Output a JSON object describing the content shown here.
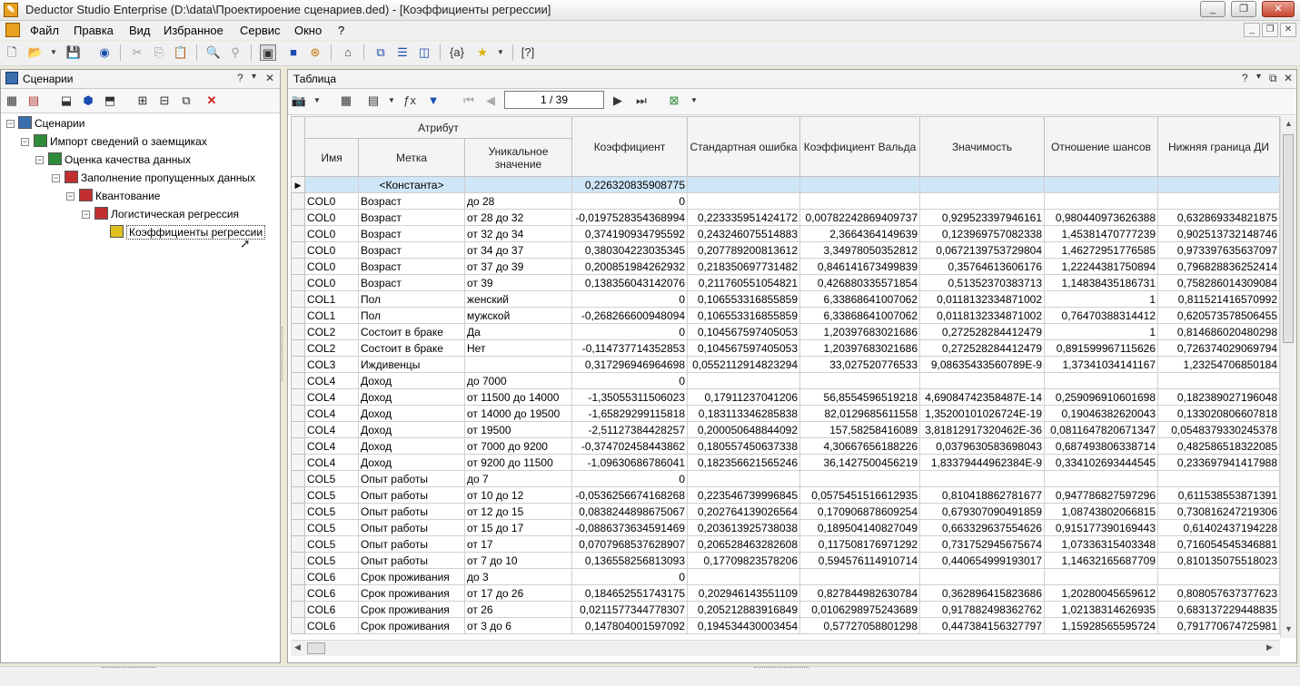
{
  "window": {
    "title": "Deductor Studio Enterprise (D:\\data\\Проектироение сценариев.ded) - [Коэффициенты регрессии]",
    "minimize": "_",
    "restore": "❐",
    "close": "✕"
  },
  "menu": [
    "Файл",
    "Правка",
    "Вид",
    "Избранное",
    "Сервис",
    "Окно",
    "?"
  ],
  "left_panel": {
    "title": "Сценарии",
    "help": "?",
    "pin": "▾",
    "close": "✕",
    "tree": [
      {
        "label": "Сценарии",
        "level": 0,
        "icon_color": "#3a6fb0"
      },
      {
        "label": "Импорт сведений о заемщиках",
        "level": 1,
        "icon_color": "#2e8b3a"
      },
      {
        "label": "Оценка качества данных",
        "level": 2,
        "icon_color": "#2e8b3a"
      },
      {
        "label": "Заполнение пропущенных данных",
        "level": 3,
        "icon_color": "#c03030"
      },
      {
        "label": "Квантование",
        "level": 4,
        "icon_color": "#c03030"
      },
      {
        "label": "Логистическая регрессия",
        "level": 5,
        "icon_color": "#c03030"
      },
      {
        "label": "Коэффициенты регрессии",
        "level": 6,
        "icon_color": "#e0c020"
      }
    ]
  },
  "right_panel": {
    "title": "Таблица",
    "help": "?",
    "pin": "▾",
    "float": "⧉",
    "close": "✕",
    "pager": "1 / 39"
  },
  "table": {
    "group_header": "Атрибут",
    "columns": [
      "Имя",
      "Метка",
      "Уникальное значение",
      "Коэффициент",
      "Стандартная ошибка",
      "Коэффициент Вальда",
      "Значимость",
      "Отношение шансов",
      "Нижняя граница ДИ"
    ],
    "rows": [
      [
        "",
        "<Константа>",
        "",
        "0,226320835908775",
        "",
        "",
        "",
        "",
        ""
      ],
      [
        "COL0",
        "Возраст",
        "до 28",
        "0",
        "",
        "",
        "",
        "",
        ""
      ],
      [
        "COL0",
        "Возраст",
        "от 28 до 32",
        "-0,0197528354368994",
        "0,223335951424172",
        "0,00782242869409737",
        "0,929523397946161",
        "0,980440973626388",
        "0,632869334821875"
      ],
      [
        "COL0",
        "Возраст",
        "от 32 до 34",
        "0,374190934795592",
        "0,243246075514883",
        "2,3664364149639",
        "0,123969757082338",
        "1,45381470777239",
        "0,902513732148746"
      ],
      [
        "COL0",
        "Возраст",
        "от 34 до 37",
        "0,380304223035345",
        "0,207789200813612",
        "3,34978050352812",
        "0,0672139753729804",
        "1,46272951776585",
        "0,973397635637097"
      ],
      [
        "COL0",
        "Возраст",
        "от 37 до 39",
        "0,200851984262932",
        "0,218350697731482",
        "0,846141673499839",
        "0,35764613606176",
        "1,22244381750894",
        "0,796828836252414"
      ],
      [
        "COL0",
        "Возраст",
        "от 39",
        "0,138356043142076",
        "0,211760551054821",
        "0,426880335571854",
        "0,51352370383713",
        "1,14838435186731",
        "0,758286014309084"
      ],
      [
        "COL1",
        "Пол",
        "женский",
        "0",
        "0,106553316855859",
        "6,33868641007062",
        "0,0118132334871002",
        "1",
        "0,811521416570992"
      ],
      [
        "COL1",
        "Пол",
        "мужской",
        "-0,268266600948094",
        "0,106553316855859",
        "6,33868641007062",
        "0,0118132334871002",
        "0,76470388314412",
        "0,620573578506455"
      ],
      [
        "COL2",
        "Состоит в браке",
        "Да",
        "0",
        "0,104567597405053",
        "1,20397683021686",
        "0,272528284412479",
        "1",
        "0,814686020480298"
      ],
      [
        "COL2",
        "Состоит в браке",
        "Нет",
        "-0,114737714352853",
        "0,104567597405053",
        "1,20397683021686",
        "0,272528284412479",
        "0,891599967115626",
        "0,726374029069794"
      ],
      [
        "COL3",
        "Иждивенцы",
        "",
        "0,317296946964698",
        "0,0552112914823294",
        "33,027520776533",
        "9,08635433560789E-9",
        "1,37341034141167",
        "1,23254706850184"
      ],
      [
        "COL4",
        "Доход",
        "до 7000",
        "0",
        "",
        "",
        "",
        "",
        ""
      ],
      [
        "COL4",
        "Доход",
        "от 11500 до 14000",
        "-1,35055311506023",
        "0,17911237041206",
        "56,8554596519218",
        "4,69084742358487E-14",
        "0,259096910601698",
        "0,182389027196048"
      ],
      [
        "COL4",
        "Доход",
        "от 14000 до 19500",
        "-1,65829299115818",
        "0,183113346285838",
        "82,0129685611558",
        "1,35200101026724E-19",
        "0,19046382620043",
        "0,133020806607818"
      ],
      [
        "COL4",
        "Доход",
        "от 19500",
        "-2,51127384428257",
        "0,200050648844092",
        "157,58258416089",
        "3,81812917320462E-36",
        "0,0811647820671347",
        "0,0548379330245378"
      ],
      [
        "COL4",
        "Доход",
        "от 7000 до 9200",
        "-0,374702458443862",
        "0,180557450637338",
        "4,30667656188226",
        "0,0379630583698043",
        "0,687493806338714",
        "0,482586518322085"
      ],
      [
        "COL4",
        "Доход",
        "от 9200 до 11500",
        "-1,09630686786041",
        "0,182356621565246",
        "36,1427500456219",
        "1,83379444962384E-9",
        "0,334102693444545",
        "0,233697941417988"
      ],
      [
        "COL5",
        "Опыт работы",
        "до 7",
        "0",
        "",
        "",
        "",
        "",
        ""
      ],
      [
        "COL5",
        "Опыт работы",
        "от 10 до 12",
        "-0,0536256674168268",
        "0,223546739996845",
        "0,0575451516612935",
        "0,810418862781677",
        "0,947786827597296",
        "0,611538553871391"
      ],
      [
        "COL5",
        "Опыт работы",
        "от 12 до 15",
        "0,0838244898675067",
        "0,202764139026564",
        "0,170906878609254",
        "0,679307090491859",
        "1,08743802066815",
        "0,730816247219306"
      ],
      [
        "COL5",
        "Опыт работы",
        "от 15 до 17",
        "-0,0886373634591469",
        "0,203613925738038",
        "0,189504140827049",
        "0,663329637554626",
        "0,915177390169443",
        "0,61402437194228"
      ],
      [
        "COL5",
        "Опыт работы",
        "от 17",
        "0,0707968537628907",
        "0,206528463282608",
        "0,117508176971292",
        "0,731752945675674",
        "1,07336315403348",
        "0,716054545346881"
      ],
      [
        "COL5",
        "Опыт работы",
        "от 7 до 10",
        "0,136558256813093",
        "0,17709823578206",
        "0,594576114910714",
        "0,440654999193017",
        "1,14632165687709",
        "0,810135075518023"
      ],
      [
        "COL6",
        "Срок проживания",
        "до 3",
        "0",
        "",
        "",
        "",
        "",
        ""
      ],
      [
        "COL6",
        "Срок проживания",
        "от 17 до 26",
        "0,184652551743175",
        "0,202946143551109",
        "0,827844982630784",
        "0,362896415823686",
        "1,20280045659612",
        "0,808057637377623"
      ],
      [
        "COL6",
        "Срок проживания",
        "от 26",
        "0,0211577344778307",
        "0,205212883916849",
        "0,0106298975243689",
        "0,917882498362762",
        "1,02138314626935",
        "0,683137229448835"
      ],
      [
        "COL6",
        "Срок проживания",
        "от 3 до 6",
        "0,147804001597092",
        "0,194534430003454",
        "0,57727058801298",
        "0,447384156327797",
        "1,15928565595724",
        "0,791770674725981"
      ]
    ]
  }
}
